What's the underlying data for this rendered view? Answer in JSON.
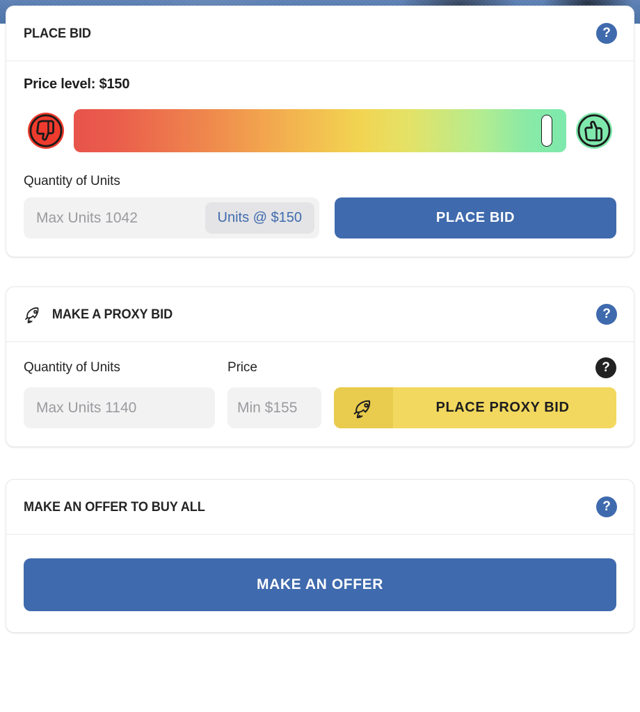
{
  "theme": {
    "primary_blue": "#3f6aad",
    "proxy_yellow": "#f2d85e",
    "proxy_yellow_dark": "#e9cb4d",
    "negative_red": "#ee3b2d",
    "positive_green": "#7fe8ac",
    "help_black": "#222222",
    "backdrop_blue": "#5279ae"
  },
  "place_bid": {
    "title": "PLACE BID",
    "help_label": "?",
    "price_level_text": "Price level: $150",
    "slider": {
      "thumb_position_percent": 96,
      "negative_icon": "thumbs-down-icon",
      "positive_icon": "thumbs-up-icon"
    },
    "quantity_label": "Quantity of Units",
    "quantity_placeholder": "Max Units 1042",
    "quantity_value": "",
    "unit_badge": "Units @ $150",
    "submit_label": "PLACE BID"
  },
  "proxy_bid": {
    "title": "MAKE A PROXY BID",
    "title_icon": "rocket-icon",
    "help_label": "?",
    "quantity_label": "Quantity of Units",
    "quantity_placeholder": "Max Units 1140",
    "quantity_value": "",
    "price_label": "Price",
    "price_placeholder": "Min $155",
    "price_value": "",
    "submit_label": "PLACE PROXY BID",
    "submit_icon": "rocket-icon"
  },
  "offer": {
    "title": "MAKE AN OFFER TO BUY ALL",
    "help_label": "?",
    "submit_label": "MAKE AN OFFER"
  }
}
